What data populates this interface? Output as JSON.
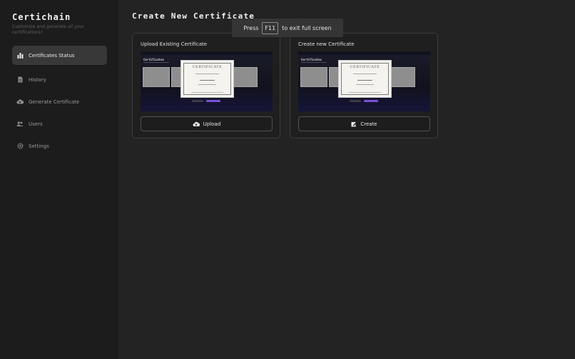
{
  "sidebar": {
    "brand": "Certichain",
    "tagline": "Customize and generate all your certifications!",
    "items": [
      {
        "label": "Certificates Status",
        "icon": "bar-chart-icon",
        "active": true
      },
      {
        "label": "History",
        "icon": "document-icon"
      },
      {
        "label": "Generate Certificate",
        "icon": "cloud-upload-icon"
      },
      {
        "label": "Users",
        "icon": "users-icon"
      },
      {
        "label": "Settings",
        "icon": "gear-icon"
      }
    ]
  },
  "main": {
    "title": "Create New Certificate",
    "cards": [
      {
        "title": "Upload Existing Certificate",
        "button": "Upload",
        "icon": "cloud-upload-icon"
      },
      {
        "title": "Create new Certificate",
        "button": "Create",
        "icon": "edit-icon"
      }
    ],
    "preview": {
      "brand": "Certificates",
      "cert_title": "CERTIFICATE"
    }
  },
  "toast": {
    "prefix": "Press",
    "key": "F11",
    "suffix": "to exit full screen"
  },
  "colors": {
    "accent": "#7b4fd6",
    "background": "#232323",
    "sidebar": "#1c1c1c"
  }
}
